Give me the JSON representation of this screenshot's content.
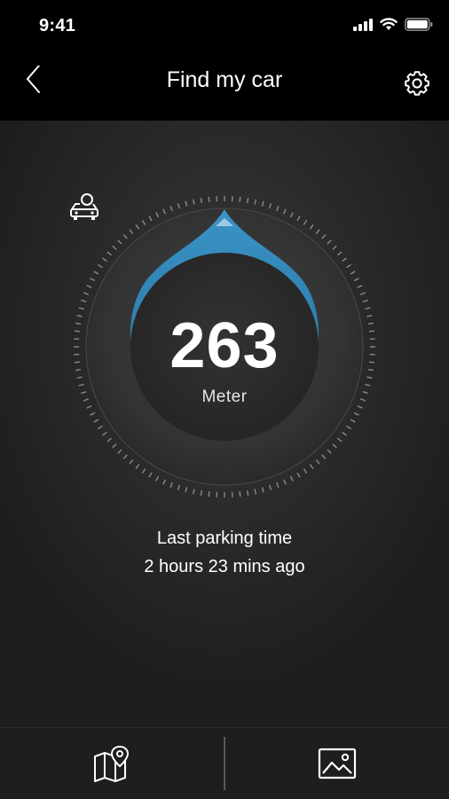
{
  "status_bar": {
    "time": "9:41",
    "icons": [
      "signal-icon",
      "wifi-icon",
      "battery-icon"
    ]
  },
  "nav": {
    "title": "Find my car",
    "back_icon": "chevron-left-icon",
    "settings_icon": "gear-icon"
  },
  "dial": {
    "icon": "car-icon",
    "distance": "263",
    "unit": "Meter",
    "accent_color": "#2e86b8"
  },
  "parking": {
    "label": "Last parking time",
    "ago": "2 hours 23 mins ago"
  },
  "tab_bar": {
    "items": [
      {
        "icon": "map-pin-icon"
      },
      {
        "icon": "image-icon"
      }
    ]
  }
}
